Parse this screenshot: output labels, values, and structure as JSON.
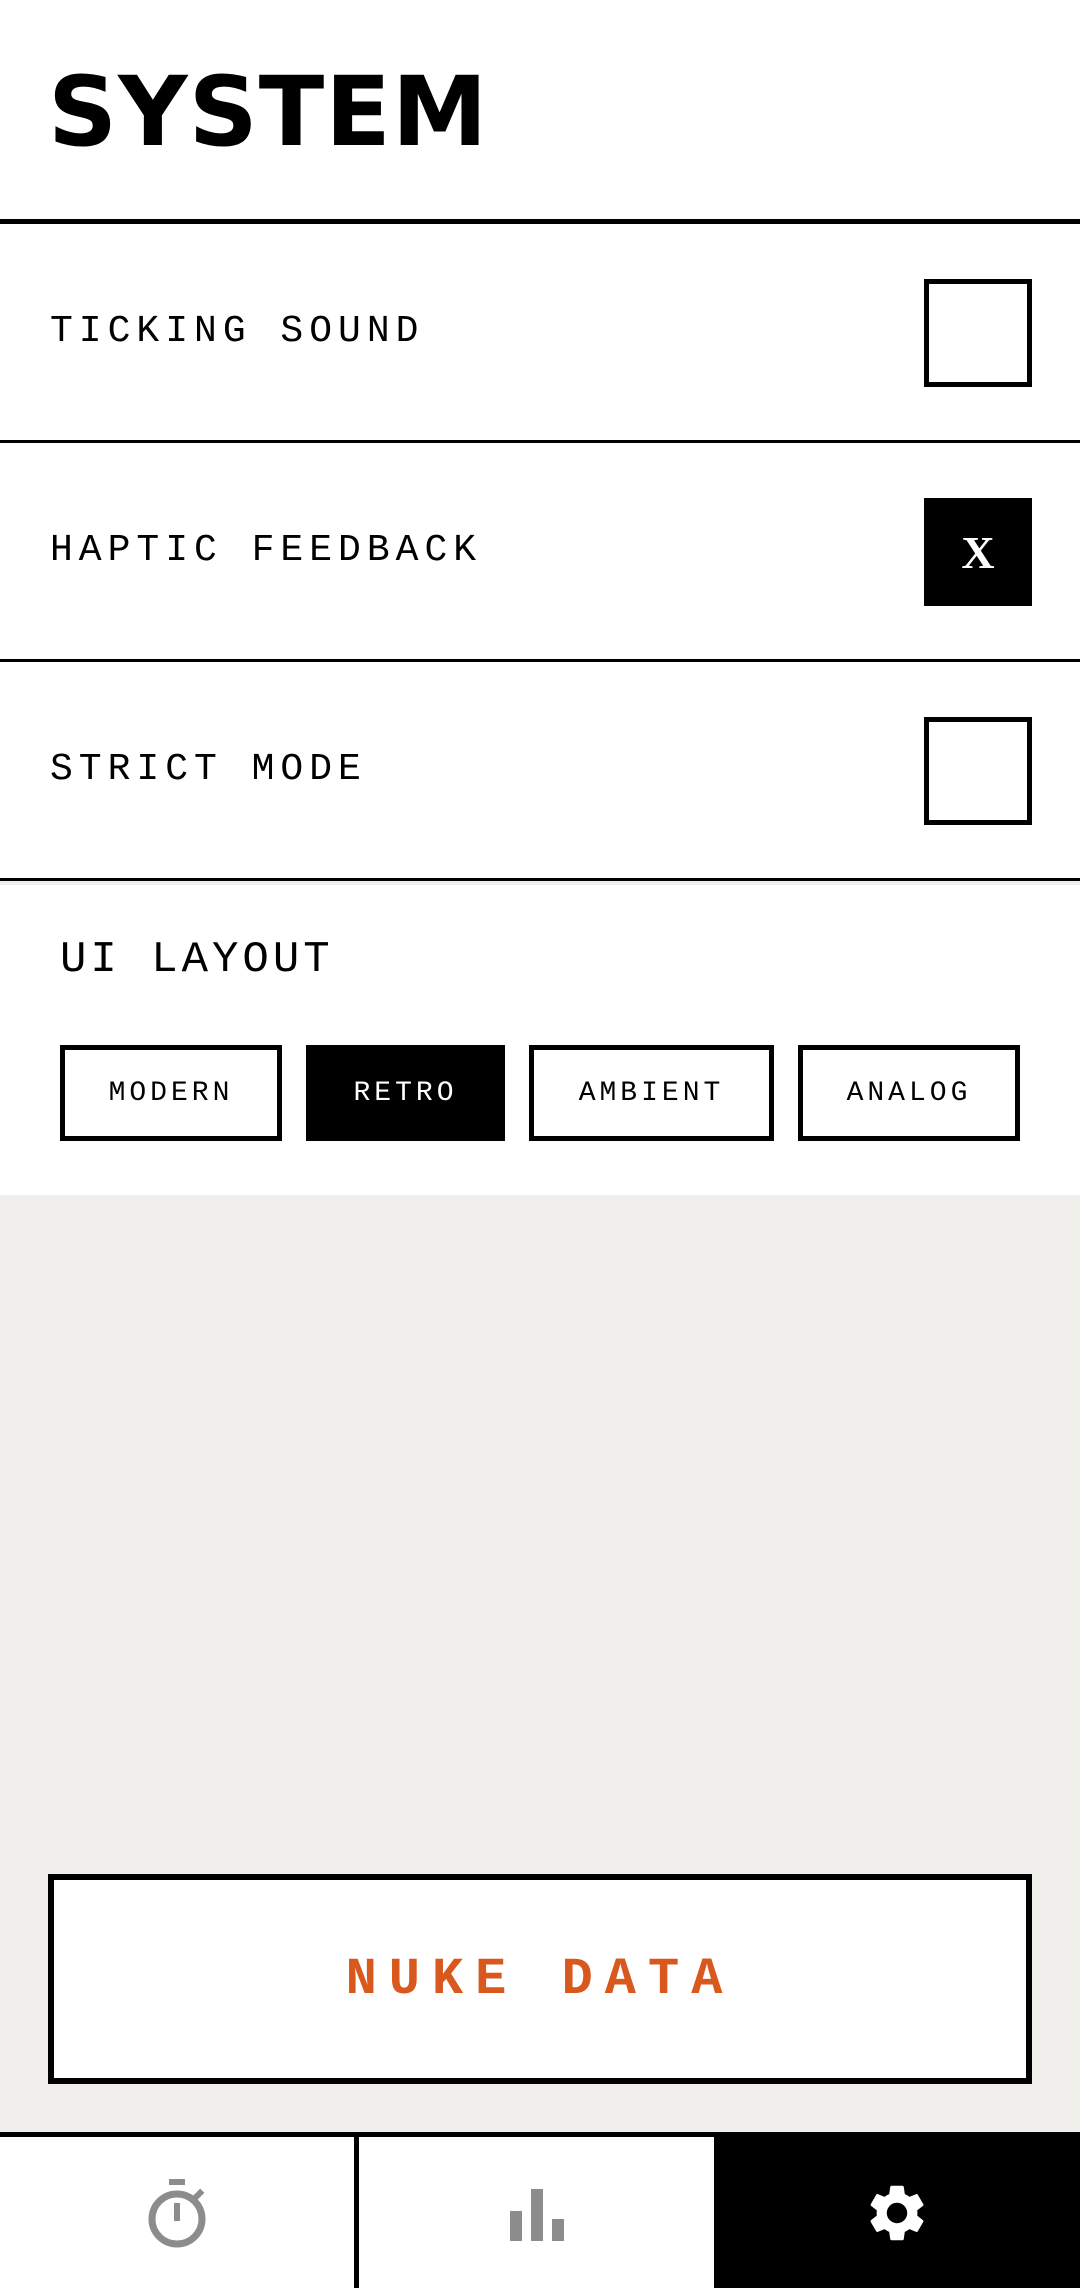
{
  "header": {
    "title": "SYSTEM"
  },
  "settings": [
    {
      "label": "TICKING SOUND",
      "checked": false,
      "mark": ""
    },
    {
      "label": "HAPTIC FEEDBACK",
      "checked": true,
      "mark": "X"
    },
    {
      "label": "STRICT MODE",
      "checked": false,
      "mark": ""
    }
  ],
  "layout": {
    "title": "UI LAYOUT",
    "options": [
      "MODERN",
      "RETRO",
      "AMBIENT",
      "ANALOG"
    ],
    "selected": "RETRO"
  },
  "actions": {
    "nuke_label": "NUKE DATA",
    "nuke_color": "#d9581e"
  },
  "nav": {
    "items": [
      {
        "icon": "stopwatch-icon",
        "active": false
      },
      {
        "icon": "bar-chart-icon",
        "active": false
      },
      {
        "icon": "gear-icon",
        "active": true
      }
    ]
  }
}
